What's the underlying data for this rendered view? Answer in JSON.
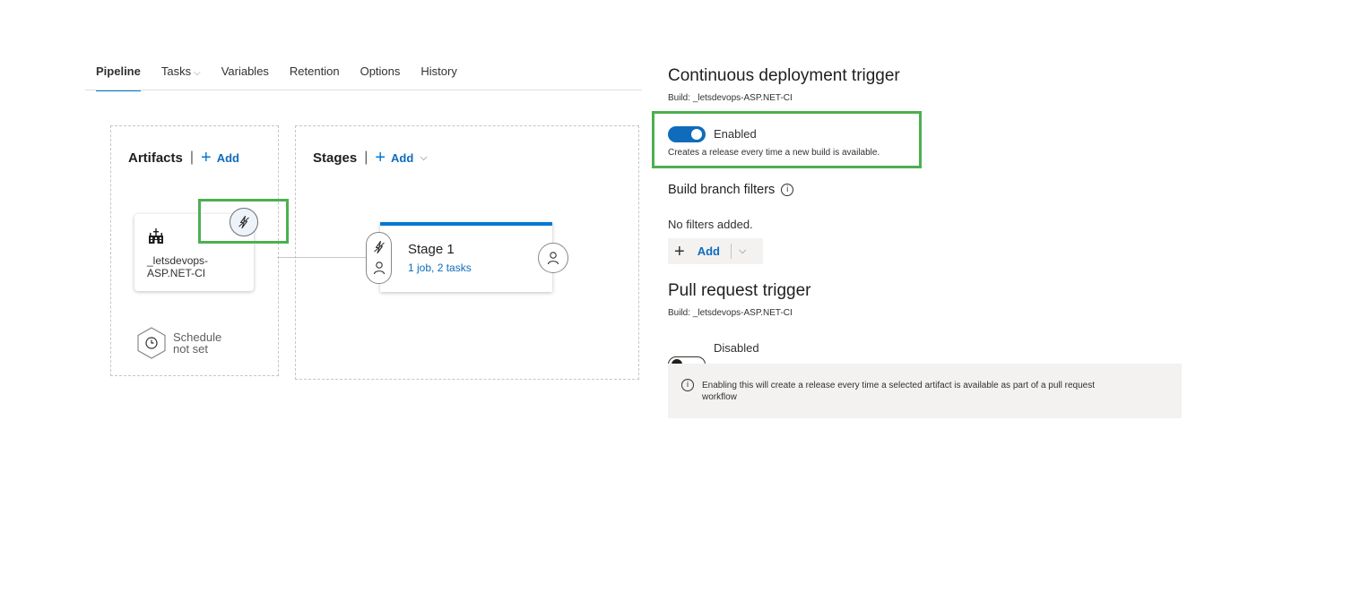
{
  "tabs": [
    {
      "label": "Pipeline",
      "active": true
    },
    {
      "label": "Tasks",
      "has_dropdown": true
    },
    {
      "label": "Variables"
    },
    {
      "label": "Retention"
    },
    {
      "label": "Options"
    },
    {
      "label": "History"
    }
  ],
  "artifacts": {
    "title": "Artifacts",
    "add_label": "Add",
    "artifact": {
      "name_line1": "_letsdevops-",
      "name_line2": "ASP.NET-CI",
      "icon": "build-artifact-icon"
    },
    "trigger_icon": "lightning-icon",
    "schedule": {
      "line1": "Schedule",
      "line2": "not set",
      "icon": "clock-icon"
    }
  },
  "stages": {
    "title": "Stages",
    "add_label": "Add",
    "stage": {
      "name": "Stage 1",
      "summary": "1 job, 2 tasks"
    },
    "icons": [
      "lightning-icon",
      "person-icon"
    ]
  },
  "cd_trigger": {
    "title": "Continuous deployment trigger",
    "build_label": "Build: _letsdevops-ASP.NET-CI",
    "toggle_state": "on",
    "toggle_label": "Enabled",
    "description": "Creates a release every time a new build is available."
  },
  "branch_filters": {
    "title": "Build branch filters",
    "empty_text": "No filters added.",
    "add_label": "Add"
  },
  "pr_trigger": {
    "title": "Pull request trigger",
    "build_label": "Build: _letsdevops-ASP.NET-CI",
    "toggle_state": "off",
    "toggle_label": "Disabled",
    "info_line1": "Enabling this will create a release every time a selected artifact is available as part of a pull request",
    "info_line2": "workflow"
  },
  "colors": {
    "accent": "#0078d4",
    "link": "#0f6cbd",
    "highlight": "#4caf50"
  }
}
